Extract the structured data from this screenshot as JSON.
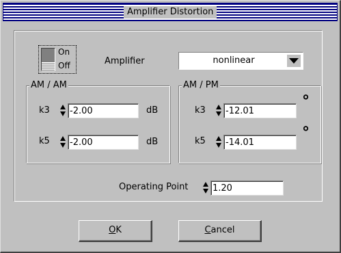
{
  "window": {
    "title": "Amplifier Distortion"
  },
  "switch": {
    "on_label": "On",
    "off_label": "Off",
    "state": "off"
  },
  "amplifier": {
    "label": "Amplifier",
    "selected": "nonlinear"
  },
  "am_am": {
    "title": "AM / AM",
    "k3": {
      "label": "k3",
      "value": "-2.00",
      "unit": "dB"
    },
    "k5": {
      "label": "k5",
      "value": "-2.00",
      "unit": "dB"
    }
  },
  "am_pm": {
    "title": "AM / PM",
    "k3": {
      "label": "k3",
      "value": "-12.01",
      "unit": "°"
    },
    "k5": {
      "label": "k5",
      "value": "-14.01",
      "unit": "°"
    }
  },
  "operating_point": {
    "label": "Operating Point",
    "value": "1.20"
  },
  "buttons": {
    "ok": {
      "mnemonic": "O",
      "rest": "K"
    },
    "cancel": {
      "mnemonic": "C",
      "rest": "ancel"
    }
  },
  "colors": {
    "face": "#c0c0c0",
    "title_stripe": "#000080"
  },
  "icons": [
    "up-down-spinner-icon",
    "dropdown-arrow-icon",
    "toggle-switch-icon",
    "degree-icon"
  ]
}
